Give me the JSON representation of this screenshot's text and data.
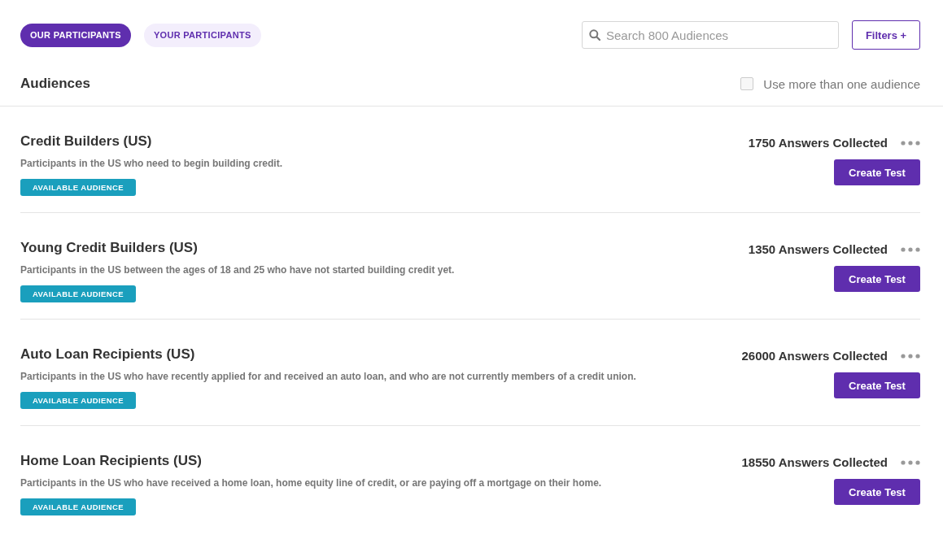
{
  "tabs": [
    {
      "label": "OUR PARTICIPANTS",
      "selected": true
    },
    {
      "label": "YOUR PARTICIPANTS",
      "selected": false
    }
  ],
  "search": {
    "placeholder": "Search 800 Audiences"
  },
  "filters_button": "Filters +",
  "header": {
    "title": "Audiences",
    "multi_select": {
      "label": "Use more than one audience",
      "checked": false
    }
  },
  "audiences": [
    {
      "name": "Credit Builders (US)",
      "description": "Participants in the US who need to begin building credit.",
      "badge": "AVAILABLE AUDIENCE",
      "answers": "1750 Answers Collected",
      "action": "Create Test"
    },
    {
      "name": "Young Credit Builders (US)",
      "description": "Participants in the US between the ages of 18 and 25 who have not started building credit yet.",
      "badge": "AVAILABLE AUDIENCE",
      "answers": "1350 Answers Collected",
      "action": "Create Test"
    },
    {
      "name": "Auto Loan Recipients (US)",
      "description": "Participants in the US who have recently applied for and received an auto loan, and who are not currently members of a credit union.",
      "badge": "AVAILABLE AUDIENCE",
      "answers": "26000 Answers Collected",
      "action": "Create Test"
    },
    {
      "name": "Home Loan Recipients (US)",
      "description": "Participants in the US who have received a home loan, home equity line of credit, or are paying off a mortgage on their home.",
      "badge": "AVAILABLE AUDIENCE",
      "answers": "18550 Answers Collected",
      "action": "Create Test"
    }
  ]
}
